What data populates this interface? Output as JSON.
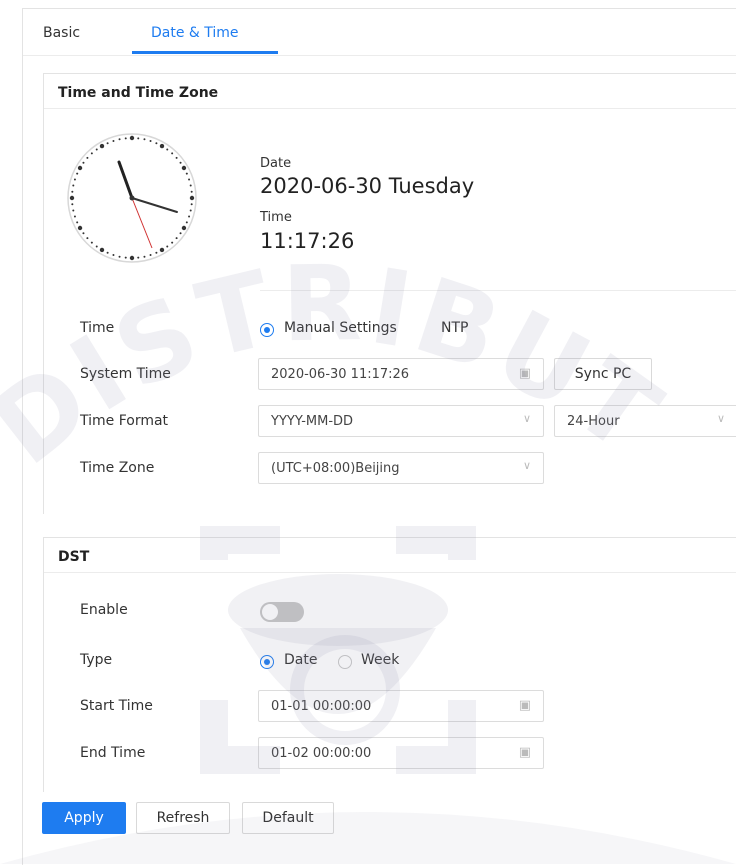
{
  "tabs": [
    {
      "label": "Basic",
      "active": false
    },
    {
      "label": "Date & Time",
      "active": true
    }
  ],
  "time_zone_section": {
    "title": "Time and Time Zone",
    "date_label": "Date",
    "date_value": "2020-06-30 Tuesday",
    "time_label": "Time",
    "time_value": "11:17:26",
    "rows": {
      "time": {
        "label": "Time",
        "options": [
          {
            "label": "Manual Settings",
            "selected": true
          },
          {
            "label": "NTP",
            "selected": false
          }
        ]
      },
      "system_time": {
        "label": "System Time",
        "value": "2020-06-30 11:17:26",
        "icon": "calendar-icon"
      },
      "sync_pc_label": "Sync PC",
      "time_format": {
        "label": "Time Format",
        "date_format": "YYYY-MM-DD",
        "hour_format": "24-Hour"
      },
      "time_zone": {
        "label": "Time Zone",
        "value": "(UTC+08:00)Beijing"
      }
    }
  },
  "dst_section": {
    "title": "DST",
    "enable": {
      "label": "Enable",
      "on": false
    },
    "type": {
      "label": "Type",
      "options": [
        {
          "label": "Date",
          "selected": true
        },
        {
          "label": "Week",
          "selected": false
        }
      ]
    },
    "start_time": {
      "label": "Start Time",
      "value": "01-01 00:00:00"
    },
    "end_time": {
      "label": "End Time",
      "value": "01-02 00:00:00"
    }
  },
  "actions": {
    "apply": "Apply",
    "refresh": "Refresh",
    "default": "Default"
  },
  "watermark_text": "DISTRIBUT",
  "colors": {
    "accent": "#1e7cf0",
    "toggle_off": "#c6c6c6"
  }
}
